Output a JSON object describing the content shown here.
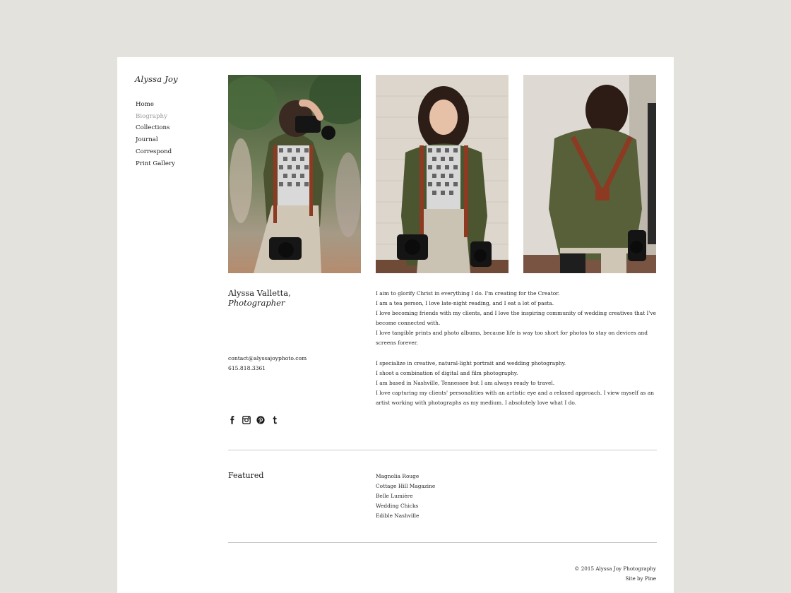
{
  "site": {
    "title": "Alyssa Joy"
  },
  "nav": {
    "items": [
      {
        "label": "Home"
      },
      {
        "label": "Biography"
      },
      {
        "label": "Collections"
      },
      {
        "label": "Journal"
      },
      {
        "label": "Correspond"
      },
      {
        "label": "Print Gallery"
      }
    ],
    "active": "Biography"
  },
  "photos": [
    {
      "subject": "photographer-aiming-camera"
    },
    {
      "subject": "photographer-smiling-portrait"
    },
    {
      "subject": "photographer-back-view-harness"
    }
  ],
  "bio": {
    "name": "Alyssa Valletta,",
    "role": "Photographer",
    "email": "contact@alyssajoyphoto.com",
    "phone": "615.818.3361",
    "paragraphs": [
      [
        "I aim to glorify Christ in everything I do. I'm creating for the Creator.",
        "I am a tea person, I love late-night reading, and I eat a lot of pasta.",
        "I love becoming friends with my clients, and I love the inspiring community of wedding creatives that I've become connected with.",
        "I love tangible prints and photo albums, because life is way too short for photos to stay on devices and screens forever."
      ],
      [
        "I specialize in creative, natural-light portrait and wedding photography.",
        "I shoot a combination of digital and film photography.",
        "I am based in Nashville, Tennessee but I am always ready to travel.",
        "I love capturing my clients' personalities with an artistic eye and a relaxed approach. I view myself as an artist working with photographs as my medium. I absolutely love what I do."
      ]
    ]
  },
  "social": [
    {
      "icon": "facebook-icon"
    },
    {
      "icon": "instagram-icon"
    },
    {
      "icon": "pinterest-icon"
    },
    {
      "icon": "tumblr-icon"
    }
  ],
  "featured": {
    "title": "Featured",
    "items": [
      "Magnolia Rouge",
      "Cottage Hill Magazine",
      "Belle Lumière",
      "Wedding Chicks",
      "Edible Nashville"
    ]
  },
  "footer": {
    "copyright": "© 2015 Alyssa Joy Photography",
    "credit_prefix": "Site by ",
    "credit_link": "Pine"
  },
  "colors": {
    "background": "#e4e2dc",
    "page": "#ffffff",
    "nav_active": "#9a9a9a",
    "rule": "#c9c9c9"
  }
}
